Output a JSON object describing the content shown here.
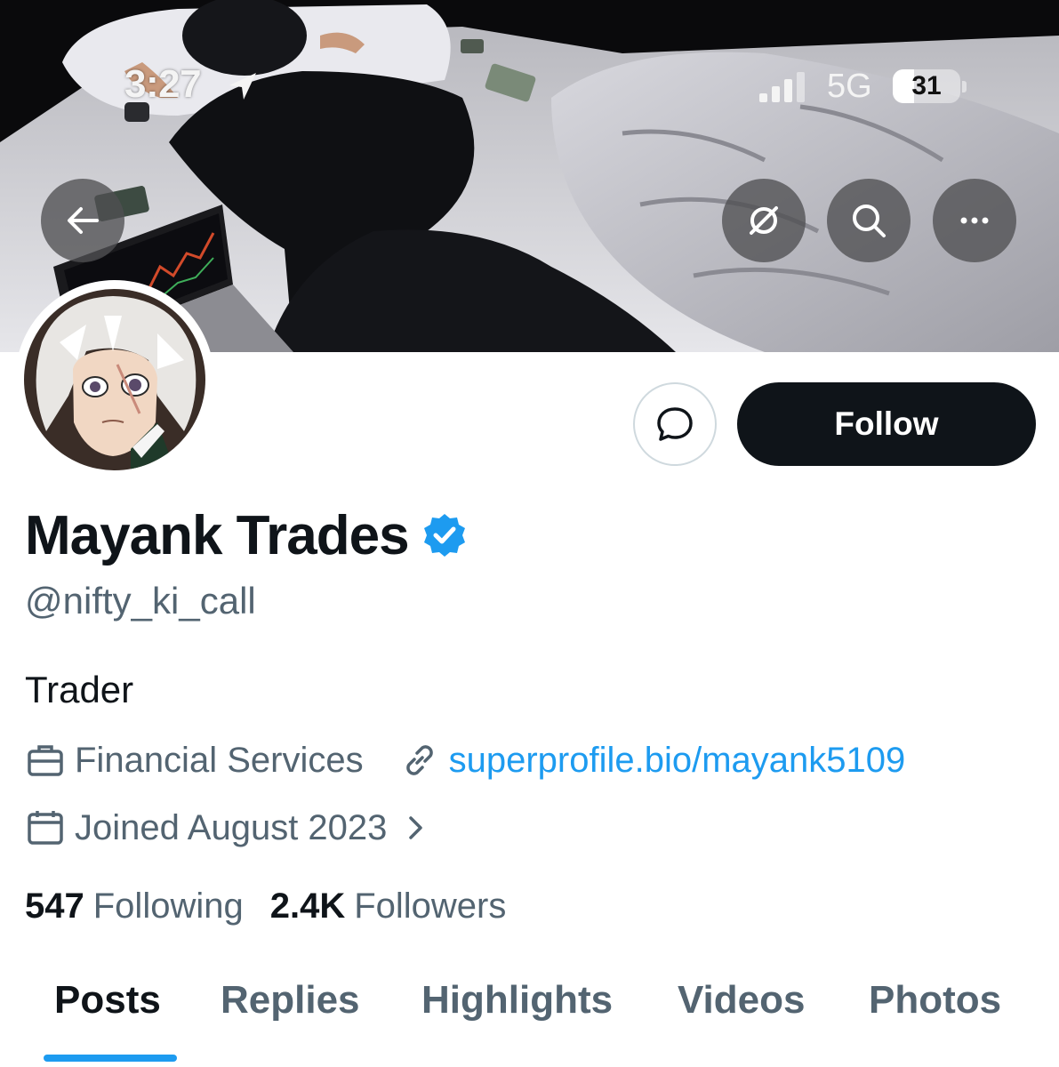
{
  "status_bar": {
    "time": "3:27",
    "network": "5G",
    "battery": "31",
    "battery_level": 0.31
  },
  "banner": {
    "back_icon": "arrow-left-icon",
    "grok_icon": "grok-icon",
    "search_icon": "search-icon",
    "more_icon": "more-horizontal-icon"
  },
  "actions": {
    "message_icon": "message-bubble-icon",
    "follow_label": "Follow"
  },
  "profile": {
    "display_name": "Mayank Trades",
    "verified_icon": "verified-badge-icon",
    "verified_color": "#1d9bf0",
    "handle": "@nifty_ki_call",
    "bio": "Trader",
    "category": "Financial Services",
    "category_icon": "briefcase-icon",
    "link_icon": "link-icon",
    "website": "superprofile.bio/mayank5109",
    "calendar_icon": "calendar-icon",
    "joined": "Joined August 2023"
  },
  "stats": {
    "following_count": "547",
    "following_label": "Following",
    "followers_count": "2.4K",
    "followers_label": "Followers"
  },
  "tabs": [
    {
      "label": "Posts",
      "active": true
    },
    {
      "label": "Replies",
      "active": false
    },
    {
      "label": "Highlights",
      "active": false
    },
    {
      "label": "Videos",
      "active": false
    },
    {
      "label": "Photos",
      "active": false
    }
  ],
  "colors": {
    "accent": "#1d9bf0",
    "text_primary": "#0f1419",
    "text_secondary": "#536471",
    "button_dark": "#0f1419"
  }
}
